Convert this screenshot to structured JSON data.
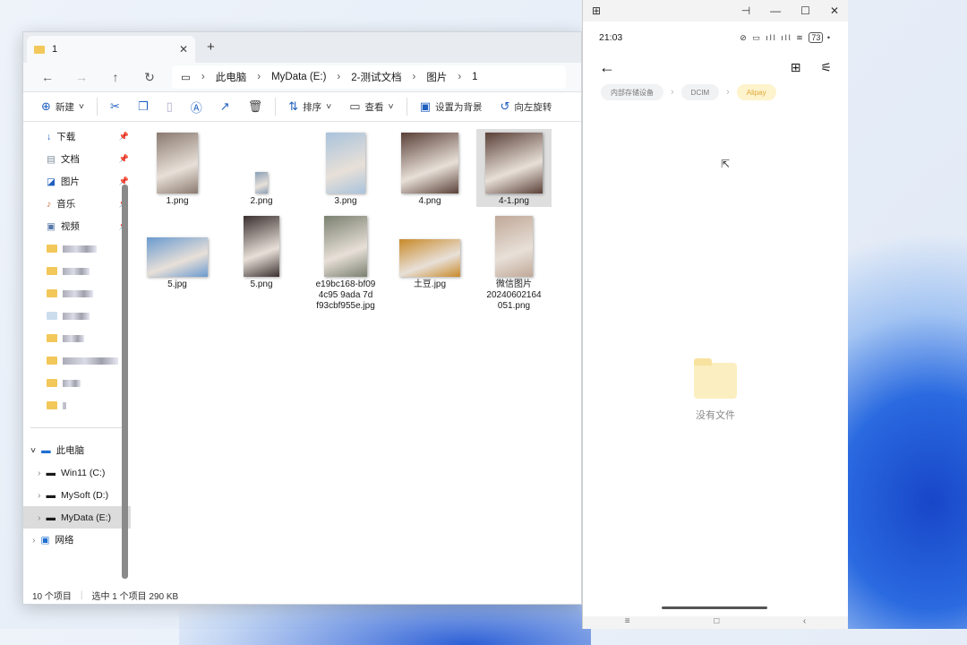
{
  "explorer": {
    "tab_title": "1",
    "breadcrumb": [
      "此电脑",
      "MyData (E:)",
      "2-测试文档",
      "图片",
      "1"
    ],
    "commands": {
      "new": "新建",
      "sort": "排序",
      "view": "查看",
      "set_bg": "设置为背景",
      "rotate": "向左旋转"
    },
    "sidebar": [
      {
        "label": "下载",
        "icon": "download-icon"
      },
      {
        "label": "文档",
        "icon": "document-icon"
      },
      {
        "label": "图片",
        "icon": "picture-icon"
      },
      {
        "label": "音乐",
        "icon": "music-icon"
      },
      {
        "label": "视频",
        "icon": "video-icon"
      }
    ],
    "tree": {
      "pc": "此电脑",
      "drives": [
        "Win11 (C:)",
        "MySoft (D:)",
        "MyData (E:)"
      ],
      "network": "网络"
    },
    "files": [
      {
        "name": "1.png",
        "thumb": "#8a7a70"
      },
      {
        "name": "2.png",
        "thumb": "#8aa0b8"
      },
      {
        "name": "3.png",
        "thumb": "#a9c3dc"
      },
      {
        "name": "4.png",
        "thumb": "#5a4038"
      },
      {
        "name": "4-1.png",
        "thumb": "#5a4038",
        "selected": true
      },
      {
        "name": "5.jpg",
        "thumb": "#6a9ad0"
      },
      {
        "name": "5.png",
        "thumb": "#3a3030"
      },
      {
        "name": "e19bc168-bf09 4c95 9ada 7d f93cbf955e.jpg",
        "thumb": "#7a8070"
      },
      {
        "name": "土豆.jpg",
        "thumb": "#c88a2a"
      },
      {
        "name": "微信图片 20240602164 051.png",
        "thumb": "#c0a898"
      }
    ],
    "status": {
      "count": "10 个项目",
      "selected": "选中 1 个项目  290 KB"
    }
  },
  "phone": {
    "time": "21:03",
    "battery": "73",
    "crumbs": [
      "内部存储设备",
      "DCIM",
      "Alipay"
    ],
    "empty_text": "没有文件"
  }
}
